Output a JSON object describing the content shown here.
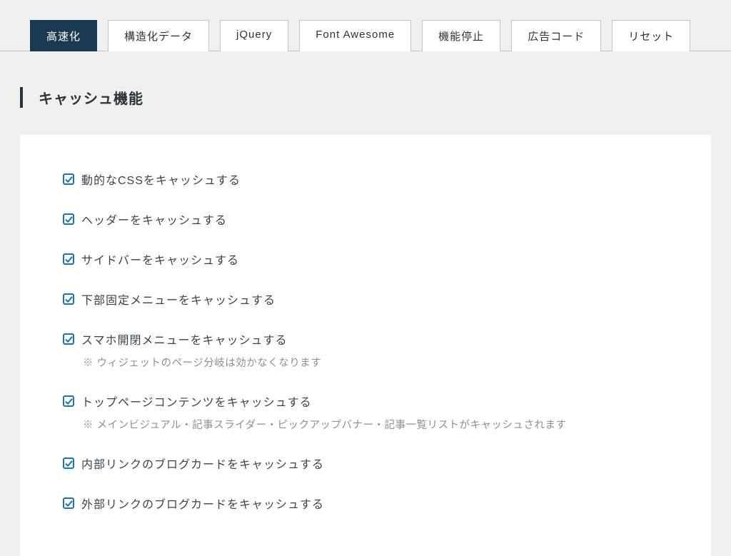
{
  "tabs": [
    {
      "label": "高速化",
      "active": true
    },
    {
      "label": "構造化データ",
      "active": false
    },
    {
      "label": "jQuery",
      "active": false
    },
    {
      "label": "Font Awesome",
      "active": false
    },
    {
      "label": "機能停止",
      "active": false
    },
    {
      "label": "広告コード",
      "active": false
    },
    {
      "label": "リセット",
      "active": false
    }
  ],
  "section_title": "キャッシュ機能",
  "options": [
    {
      "label": "動的なCSSをキャッシュする",
      "checked": true,
      "note": null
    },
    {
      "label": "ヘッダーをキャッシュする",
      "checked": true,
      "note": null
    },
    {
      "label": "サイドバーをキャッシュする",
      "checked": true,
      "note": null
    },
    {
      "label": "下部固定メニューをキャッシュする",
      "checked": true,
      "note": null
    },
    {
      "label": "スマホ開閉メニューをキャッシュする",
      "checked": true,
      "note": "※ ウィジェットのページ分岐は効かなくなります"
    },
    {
      "label": "トップページコンテンツをキャッシュする",
      "checked": true,
      "note": "※ メインビジュアル・記事スライダー・ピックアップバナー・記事一覧リストがキャッシュされます"
    },
    {
      "label": "内部リンクのブログカードをキャッシュする",
      "checked": true,
      "note": null
    },
    {
      "label": "外部リンクのブログカードをキャッシュする",
      "checked": true,
      "note": null
    }
  ]
}
